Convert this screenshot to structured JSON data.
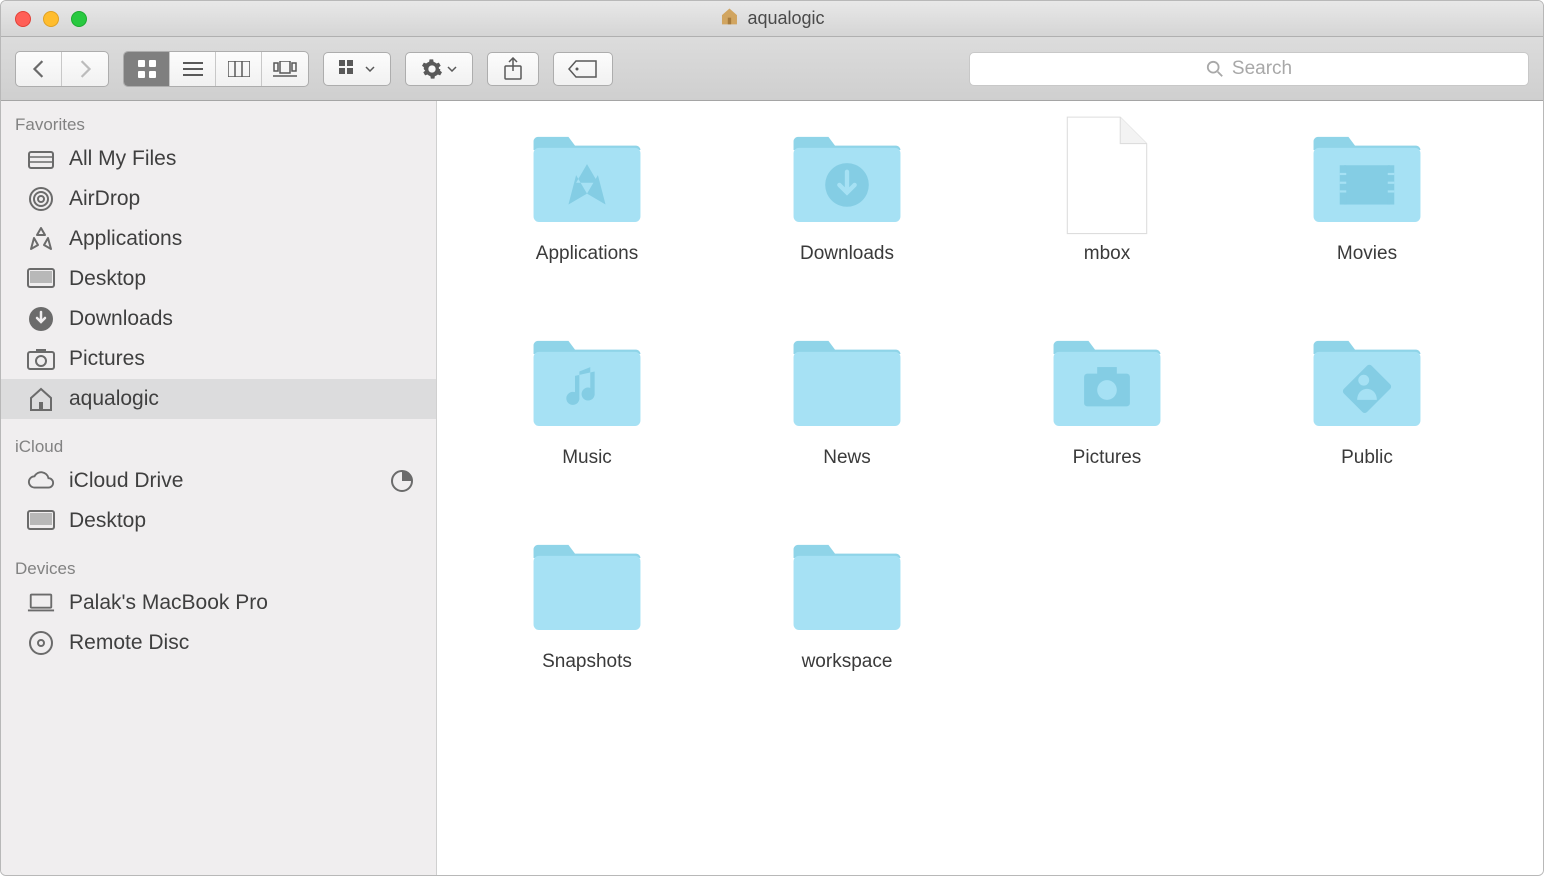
{
  "window": {
    "title": "aqualogic"
  },
  "search": {
    "placeholder": "Search"
  },
  "sidebar": {
    "sections": [
      {
        "header": "Favorites",
        "items": [
          {
            "label": "All My Files",
            "icon": "all-my-files-icon",
            "selected": false
          },
          {
            "label": "AirDrop",
            "icon": "airdrop-icon",
            "selected": false
          },
          {
            "label": "Applications",
            "icon": "applications-icon",
            "selected": false
          },
          {
            "label": "Desktop",
            "icon": "desktop-icon",
            "selected": false
          },
          {
            "label": "Downloads",
            "icon": "downloads-icon",
            "selected": false
          },
          {
            "label": "Pictures",
            "icon": "pictures-icon",
            "selected": false
          },
          {
            "label": "aqualogic",
            "icon": "home-icon",
            "selected": true
          }
        ]
      },
      {
        "header": "iCloud",
        "items": [
          {
            "label": "iCloud Drive",
            "icon": "cloud-icon",
            "selected": false,
            "progress": true
          },
          {
            "label": "Desktop",
            "icon": "desktop-icon",
            "selected": false
          }
        ]
      },
      {
        "header": "Devices",
        "items": [
          {
            "label": "Palak's MacBook Pro",
            "icon": "laptop-icon",
            "selected": false
          },
          {
            "label": "Remote Disc",
            "icon": "disc-icon",
            "selected": false
          }
        ]
      }
    ]
  },
  "items": [
    {
      "label": "Applications",
      "type": "folder",
      "glyph": "apps"
    },
    {
      "label": "Downloads",
      "type": "folder",
      "glyph": "downloads"
    },
    {
      "label": "mbox",
      "type": "file",
      "glyph": "blank"
    },
    {
      "label": "Movies",
      "type": "folder",
      "glyph": "movies"
    },
    {
      "label": "Music",
      "type": "folder",
      "glyph": "music"
    },
    {
      "label": "News",
      "type": "folder",
      "glyph": "plain"
    },
    {
      "label": "Pictures",
      "type": "folder",
      "glyph": "pictures"
    },
    {
      "label": "Public",
      "type": "folder",
      "glyph": "public"
    },
    {
      "label": "Snapshots",
      "type": "folder",
      "glyph": "plain"
    },
    {
      "label": "workspace",
      "type": "folder",
      "glyph": "plain"
    }
  ]
}
